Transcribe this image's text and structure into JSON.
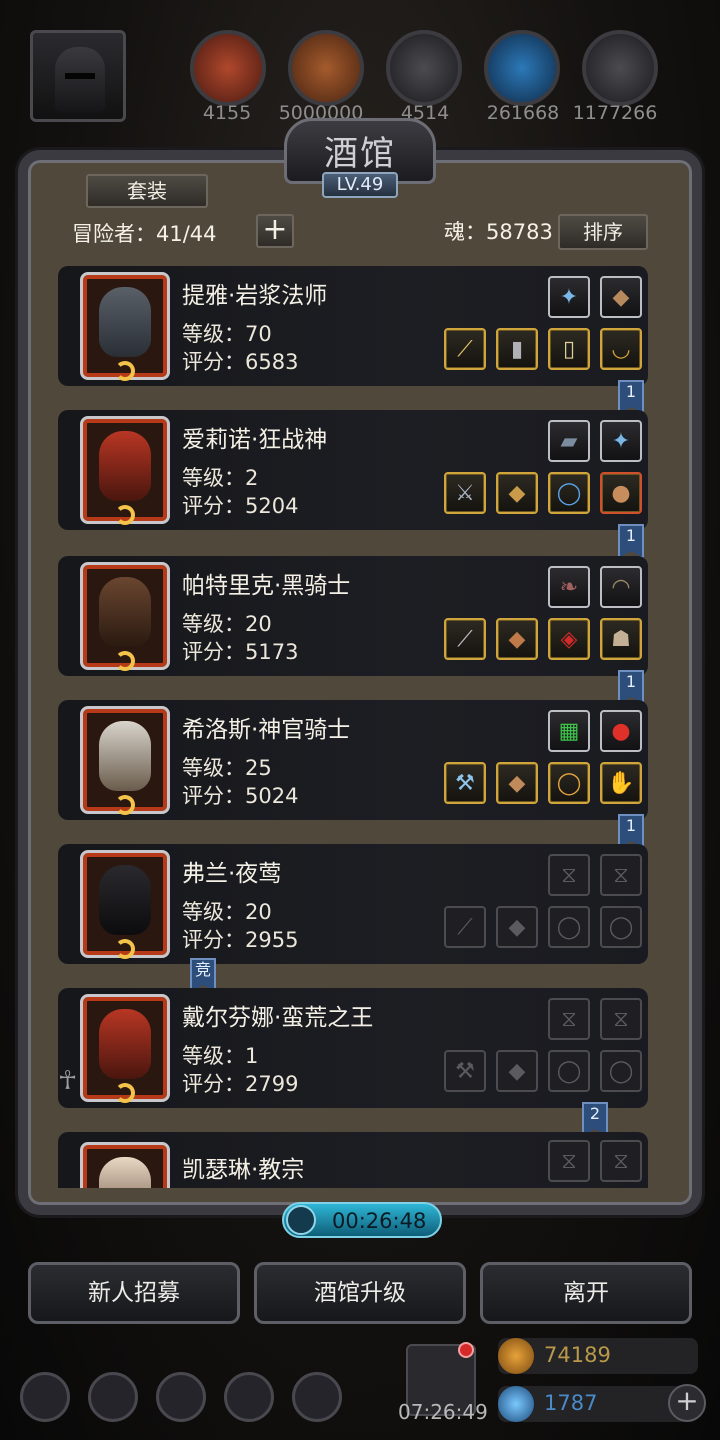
{
  "top_resources": [
    {
      "name": "wood-resource",
      "value": "4155",
      "color": "#8c3a2a"
    },
    {
      "name": "lumber-resource",
      "value": "5000000",
      "color": "#8c3a2a"
    },
    {
      "name": "iron-resource",
      "value": "4514",
      "color": "#333338"
    },
    {
      "name": "crystal-resource",
      "value": "261668",
      "color": "#1d4a7a"
    },
    {
      "name": "steel-resource",
      "value": "1177266",
      "color": "#333338"
    }
  ],
  "tavern": {
    "title": "酒馆",
    "level": "LV.49",
    "set_button": "套装",
    "adventurers_label": "冒险者：41/44",
    "add_button": "+",
    "soul_label": "魂：58783",
    "sort_button": "排序"
  },
  "heroes": [
    {
      "name": "提雅·岩浆法师",
      "level": "等级：70",
      "score": "评分：6583",
      "flag": "1"
    },
    {
      "name": "爱莉诺·狂战神",
      "level": "等级：2",
      "score": "评分：5204",
      "flag": "1"
    },
    {
      "name": "帕特里克·黑骑士",
      "level": "等级：20",
      "score": "评分：5173",
      "flag": "1"
    },
    {
      "name": "希洛斯·神官骑士",
      "level": "等级：25",
      "score": "评分：5024",
      "flag": "1"
    },
    {
      "name": "弗兰·夜莺",
      "level": "等级：20",
      "score": "评分：2955",
      "flag": "竞"
    },
    {
      "name": "戴尔芬娜·蛮荒之王",
      "level": "等级：1",
      "score": "评分：2799",
      "flag": "2"
    },
    {
      "name": "凯瑟琳·教宗",
      "level": "",
      "score": "",
      "flag": ""
    }
  ],
  "timer": "00:26:48",
  "actions": {
    "recruit": "新人招募",
    "upgrade": "酒馆升级",
    "leave": "离开"
  },
  "hud": {
    "time": "07:26:49",
    "gold": "74189",
    "gems": "1787",
    "plus": "+"
  }
}
